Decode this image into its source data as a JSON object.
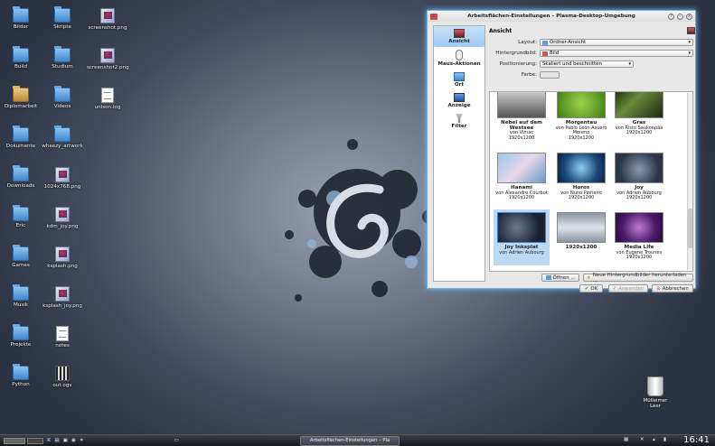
{
  "desktop": {
    "icons": [
      {
        "label": "Bilder",
        "type": "folder"
      },
      {
        "label": "Skripte",
        "type": "folder"
      },
      {
        "label": "screenshot.png",
        "type": "png"
      },
      {
        "label": "Build",
        "type": "folder"
      },
      {
        "label": "Studium",
        "type": "folder"
      },
      {
        "label": "screenshot2.png",
        "type": "png"
      },
      {
        "label": "Diplomarbeit",
        "type": "folder-brown"
      },
      {
        "label": "Videos",
        "type": "folder"
      },
      {
        "label": "unison.log",
        "type": "txt"
      },
      {
        "label": "Dokumente",
        "type": "folder"
      },
      {
        "label": "wheezy_artwork",
        "type": "folder"
      },
      {
        "label": "Downloads",
        "type": "folder"
      },
      {
        "label": "1024x768.png",
        "type": "png"
      },
      {
        "label": "Eric",
        "type": "folder"
      },
      {
        "label": "kdm_joy.png",
        "type": "png"
      },
      {
        "label": "Games",
        "type": "folder"
      },
      {
        "label": "ksplash.png",
        "type": "png"
      },
      {
        "label": "Musik",
        "type": "folder"
      },
      {
        "label": "ksplash_joy.png",
        "type": "png"
      },
      {
        "label": "Projekte",
        "type": "folder"
      },
      {
        "label": "notes",
        "type": "txt"
      },
      {
        "label": "Python",
        "type": "folder"
      },
      {
        "label": "out.ogv",
        "type": "video"
      }
    ],
    "trash_label": "Mülleimer Leer"
  },
  "dialog": {
    "title": "Arbeitsflächen-Einstellungen – Plasma-Desktop-Umgebung",
    "sidebar": [
      {
        "label": "Ansicht",
        "icon": "display-icon"
      },
      {
        "label": "Maus-Aktionen",
        "icon": "mouse-icon"
      },
      {
        "label": "Ort",
        "icon": "folder-icon"
      },
      {
        "label": "Anzeige",
        "icon": "monitor-icon"
      },
      {
        "label": "Filter",
        "icon": "filter-icon"
      }
    ],
    "section_title": "Ansicht",
    "layout_label": "Layout:",
    "layout_value": "Ordner-Ansicht",
    "wallpaper_label": "Hintergrundbild:",
    "wallpaper_value": "Bild",
    "position_label": "Positionierung:",
    "position_value": "Skaliert und beschnitten",
    "color_label": "Farbe:",
    "wallpapers": [
      {
        "name": "Nebel auf dem Westsee",
        "author": "von Vimac",
        "size": "1920x1200"
      },
      {
        "name": "Morgentau",
        "author": "von Pablo León-Asuero Moreno",
        "size": "1920x1200"
      },
      {
        "name": "Gras",
        "author": "von Risto Saukonpää",
        "size": "1920x1200"
      },
      {
        "name": "Hanami",
        "author": "von Alexandre Courbot",
        "size": "1920x1200"
      },
      {
        "name": "Horos",
        "author": "von Nuno Pinheiro",
        "size": "1920x1200"
      },
      {
        "name": "Joy",
        "author": "von Adrien Aubourg",
        "size": "1920x1200"
      },
      {
        "name": "Joy Inksplat",
        "author": "von Adrien Aubourg",
        "size": ""
      },
      {
        "name": "1920x1200",
        "author": "",
        "size": ""
      },
      {
        "name": "Media Life",
        "author": "von Eugene Trounev",
        "size": "1920x1200"
      }
    ],
    "open_button": "Öffnen ...",
    "download_button": "Neue Hintergrundbilder herunterladen ...",
    "ok_button": "OK",
    "apply_button": "Anwenden",
    "cancel_button": "Abbrechen"
  },
  "taskbar": {
    "task_label": "Arbeitsflächen-Einstellungen – Pla",
    "clock": "16:41"
  },
  "colors": {
    "accent": "#6fb4e8",
    "selection": "#bcd9f4"
  }
}
